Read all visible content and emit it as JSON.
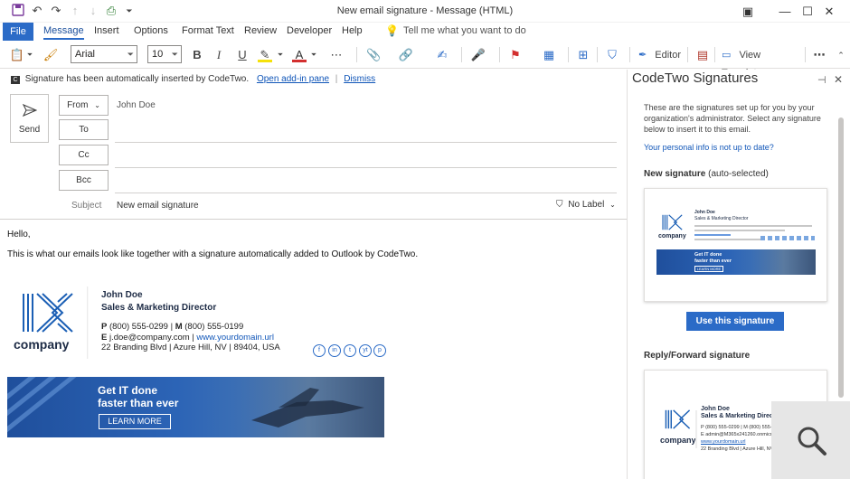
{
  "window": {
    "title": "New email signature - Message (HTML)"
  },
  "menu": {
    "file": "File",
    "tabs": [
      "Message",
      "Insert",
      "Options",
      "Format Text",
      "Review",
      "Developer",
      "Help"
    ],
    "tell_me": "Tell me what you want to do"
  },
  "ribbon": {
    "font_name": "Arial",
    "font_size": "10",
    "editor_label": "Editor",
    "view_templates_label": "View Templates"
  },
  "infobar": {
    "message": "Signature has been automatically inserted by CodeTwo.",
    "open_addin": "Open add-in pane",
    "dismiss": "Dismiss"
  },
  "compose": {
    "send_label": "Send",
    "from_label": "From",
    "from_value": "John Doe",
    "to_label": "To",
    "cc_label": "Cc",
    "bcc_label": "Bcc",
    "subject_label": "Subject",
    "subject_value": "New email signature",
    "sensitivity_label": "No Label",
    "greeting": "Hello,",
    "body_line": "This is what our emails look like together with a signature automatically added to Outlook by CodeTwo."
  },
  "signature": {
    "company": "company",
    "name": "John Doe",
    "title": "Sales & Marketing Director",
    "p_label": "P",
    "phone": "(800) 555-0299",
    "m_label": "M",
    "mobile": "(800) 555-0199",
    "e_label": "E",
    "email": "j.doe@company.com",
    "website": "www.yourdomain.url",
    "address": "22 Branding Blvd | Azure Hill, NV | 89404, USA",
    "banner_line1": "Get IT done",
    "banner_line2": "faster than ever",
    "banner_button": "LEARN MORE",
    "social": [
      "f",
      "in",
      "t",
      "yt",
      "p"
    ]
  },
  "sidepane": {
    "title": "CodeTwo Signatures",
    "intro": "These are the signatures set up for you by your organization's administrator. Select any signature below to insert it to this email.",
    "personal_link": "Your personal info is not up to date?",
    "new_sig_heading": "New signature",
    "new_sig_suffix": "(auto-selected)",
    "use_button": "Use this signature",
    "reply_heading": "Reply/Forward signature",
    "reply_email_line": "E admin@M365x241260.onmicros",
    "reply_phone_line": "P (800) 555-0299 | M (800) 555-0199",
    "reply_web_line": "www.yourdomain.url",
    "reply_address": "22 Branding Blvd | Azure Hill, NV"
  },
  "colors": {
    "accent": "#2b6bc7",
    "link": "#0f55b8",
    "logo": "#1b5fb5"
  }
}
